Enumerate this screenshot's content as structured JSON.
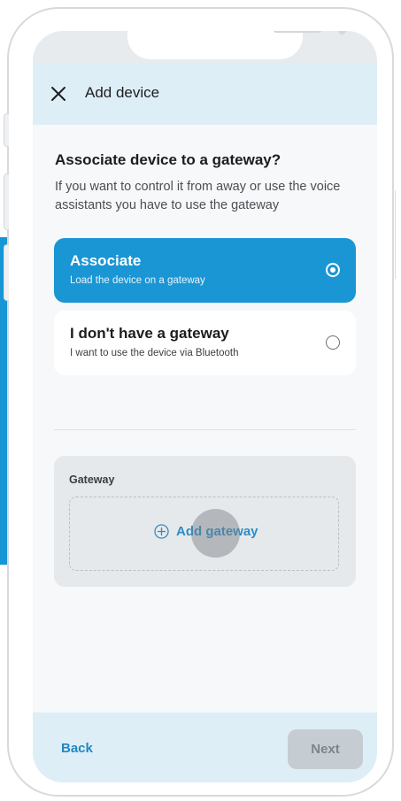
{
  "header": {
    "title": "Add device",
    "close_icon": "close-icon"
  },
  "question": {
    "title": "Associate device to a gateway?",
    "description": "If you want to control it from away or use the voice assistants you have to use the gateway"
  },
  "options": [
    {
      "title": "Associate",
      "subtitle": "Load the device on a gateway",
      "selected": true
    },
    {
      "title": "I don't have a gateway",
      "subtitle": "I want to use the device via Bluetooth",
      "selected": false
    }
  ],
  "gateway": {
    "label": "Gateway",
    "add_label": "Add gateway",
    "add_icon": "plus-circle-icon"
  },
  "footer": {
    "back_label": "Back",
    "next_label": "Next",
    "next_enabled": false
  },
  "colors": {
    "accent": "#1a96d5",
    "header_bg": "#deeef6",
    "disabled_button": "#c5cdd3"
  }
}
